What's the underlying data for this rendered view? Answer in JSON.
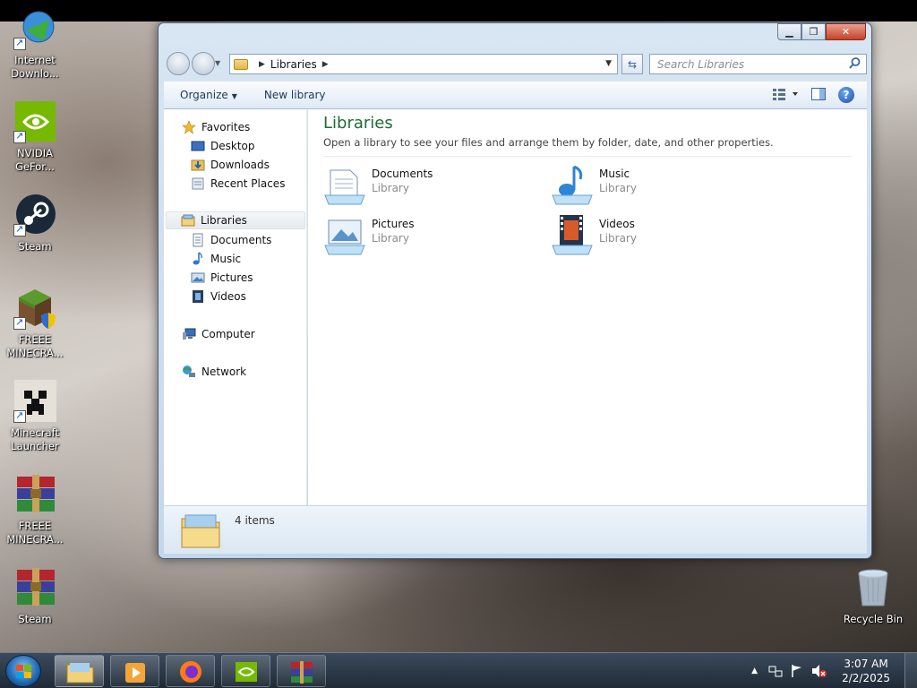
{
  "desktop": {
    "icons": [
      {
        "label": "Internet Downlo...",
        "icon": "internet-download-manager-icon"
      },
      {
        "label": "NVIDIA GeFor...",
        "icon": "nvidia-icon"
      },
      {
        "label": "Steam",
        "icon": "steam-icon"
      },
      {
        "label": "FREEE MINECRA...",
        "icon": "minecraft-grass-icon"
      },
      {
        "label": "Minecraft Launcher",
        "icon": "creeper-icon"
      },
      {
        "label": "FREEE MINECRA...",
        "icon": "winrar-icon"
      },
      {
        "label": "Steam",
        "icon": "winrar-icon"
      },
      {
        "label": "Recycle Bin",
        "icon": "recycle-bin-icon"
      }
    ]
  },
  "window": {
    "controls": {
      "minimize": "▁",
      "maximize": "❐",
      "close": "✕"
    },
    "address": {
      "crumb": "Libraries"
    },
    "search": {
      "placeholder": "Search Libraries"
    },
    "toolbar": {
      "organize": "Organize",
      "new_library": "New library"
    },
    "nav": {
      "favorites": "Favorites",
      "desktop": "Desktop",
      "downloads": "Downloads",
      "recent_places": "Recent Places",
      "libraries": "Libraries",
      "documents": "Documents",
      "music": "Music",
      "pictures": "Pictures",
      "videos": "Videos",
      "computer": "Computer",
      "network": "Network"
    },
    "content": {
      "title": "Libraries",
      "subtitle": "Open a library to see your files and arrange them by folder, date, and other properties.",
      "libraries": [
        {
          "name": "Documents",
          "type": "Library"
        },
        {
          "name": "Music",
          "type": "Library"
        },
        {
          "name": "Pictures",
          "type": "Library"
        },
        {
          "name": "Videos",
          "type": "Library"
        }
      ]
    },
    "status": {
      "count": "4 items"
    }
  },
  "taskbar": {
    "apps": [
      "file-explorer-icon",
      "media-player-icon",
      "firefox-icon",
      "nvidia-icon",
      "winrar-icon"
    ],
    "clock": {
      "time": "3:07 AM",
      "date": "2/2/2025"
    }
  }
}
